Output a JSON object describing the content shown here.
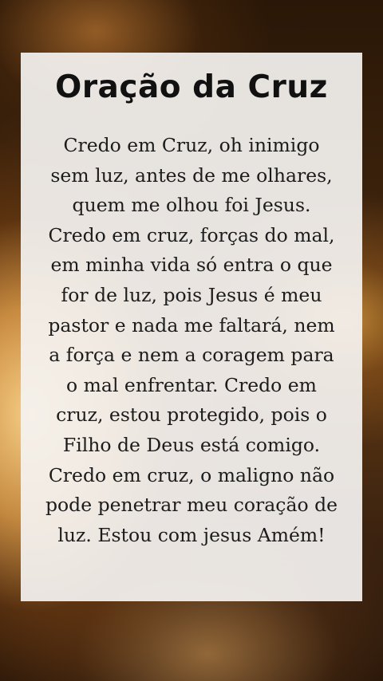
{
  "title": "Oração da Cruz",
  "prayer_lines": [
    "Credo em Cruz, oh inimigo",
    "sem luz, antes de me olhares,",
    "quem me olhou foi Jesus.",
    "Credo em cruz, forças do mal,",
    "em minha vida só entra o que",
    "for de luz, pois Jesus é meu",
    "pastor e nada me faltará, nem",
    "a força e nem a coragem para",
    "o mal enfrentar. Credo em",
    "cruz, estou protegido, pois o",
    "Filho de Deus está comigo.",
    "Credo em cruz, o maligno não",
    "pode penetrar meu coração de",
    "luz. Estou com jesus Amém!"
  ],
  "colors": {
    "card_background": "#f4f2f0",
    "text": "#1c1c1c",
    "background_glow": "#f0aa50"
  }
}
